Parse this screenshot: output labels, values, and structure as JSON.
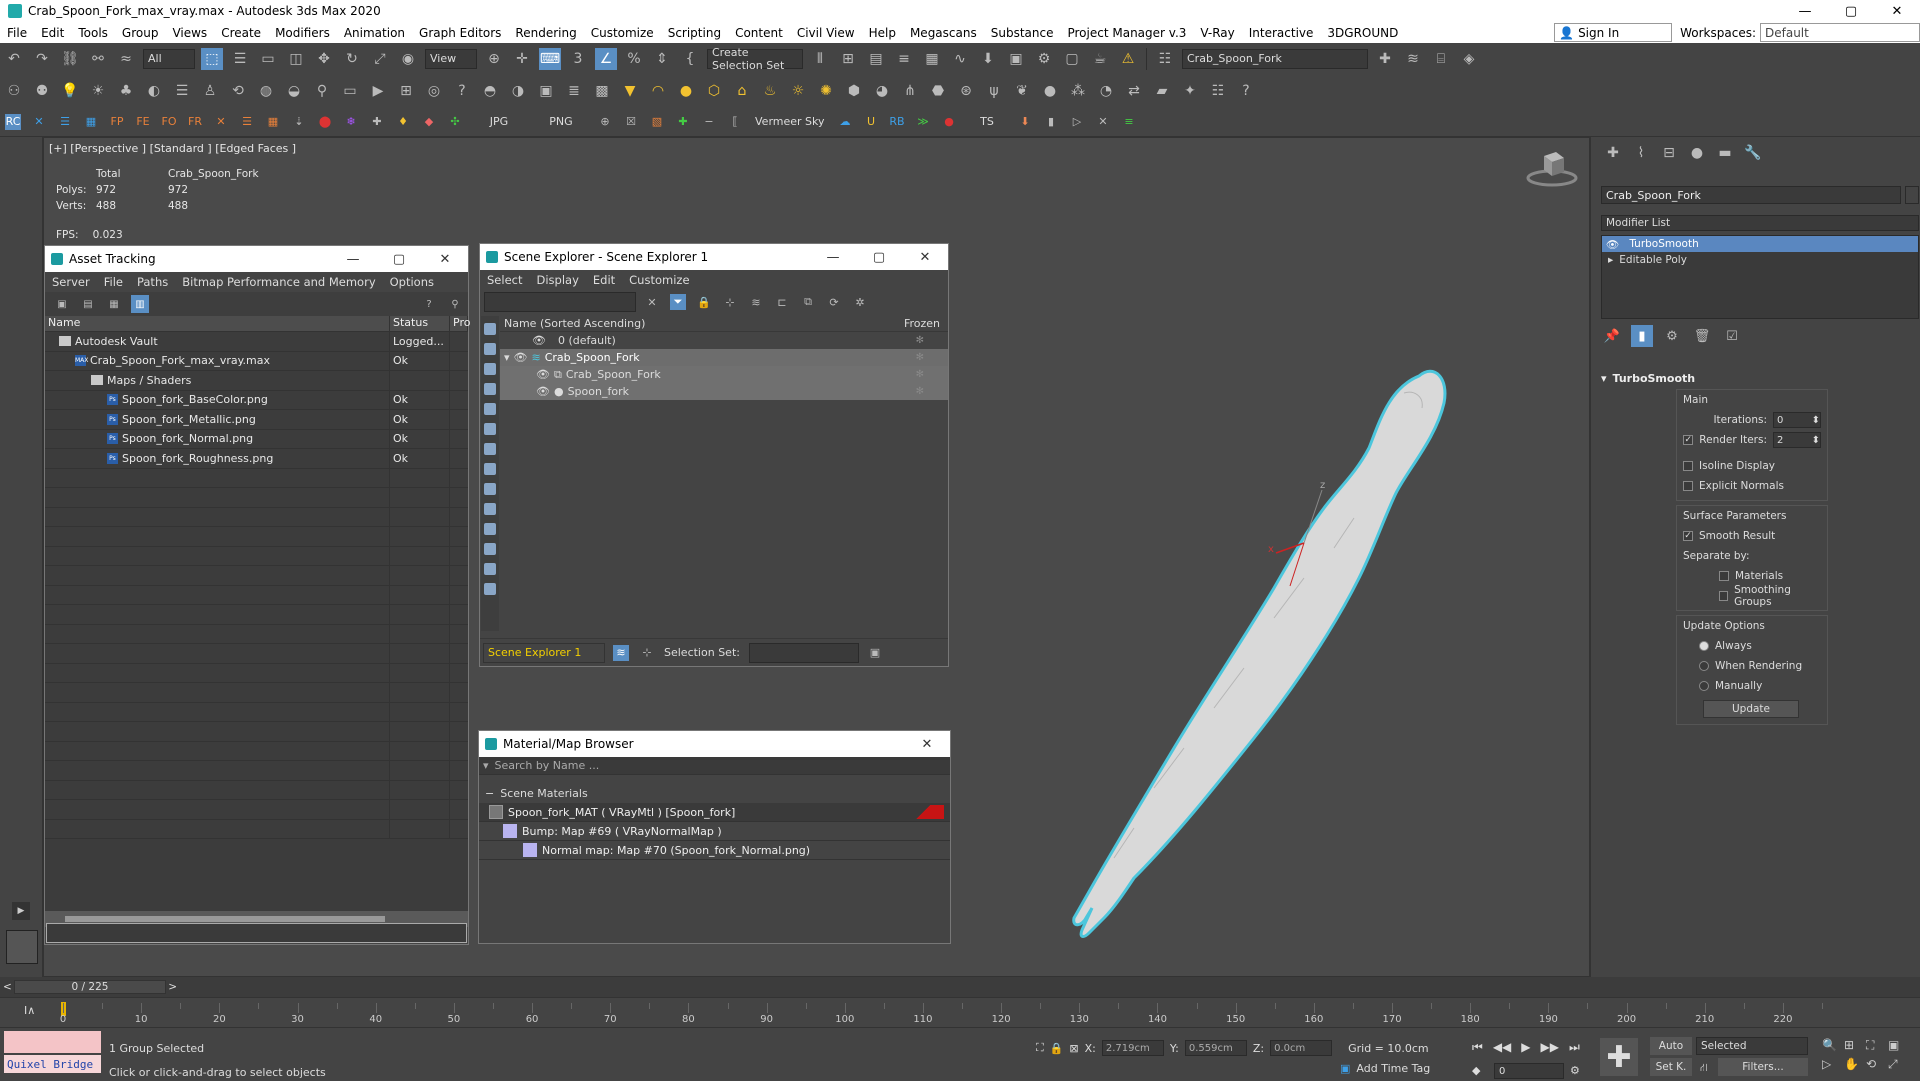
{
  "titlebar": {
    "title": "Crab_Spoon_Fork_max_vray.max - Autodesk 3ds Max 2020",
    "min": "—",
    "max": "▢",
    "close": "✕"
  },
  "menubar": {
    "items": [
      "File",
      "Edit",
      "Tools",
      "Group",
      "Views",
      "Create",
      "Modifiers",
      "Animation",
      "Graph Editors",
      "Rendering",
      "Customize",
      "Scripting",
      "Content",
      "Civil View",
      "Help",
      "Megascans",
      "Substance",
      "Project Manager v.3",
      "V-Ray",
      "Interactive",
      "3DGROUND"
    ],
    "signin": "Sign In",
    "workspaces_label": "Workspaces:",
    "workspace": "Default"
  },
  "toolbar": {
    "filter": "All",
    "refcoord": "View",
    "selection_set": "Create Selection Set",
    "layer": "Crab_Spoon_Fork",
    "jpg": "JPG",
    "png": "PNG",
    "vermeer": "Vermeer Sky",
    "ts": "TS"
  },
  "viewport": {
    "label": "[+] [Perspective ] [Standard ] [Edged Faces ]",
    "stats_header_total": "Total",
    "stats_header_obj": "Crab_Spoon_Fork",
    "polys_label": "Polys:",
    "polys_total": "972",
    "polys_obj": "972",
    "verts_label": "Verts:",
    "verts_total": "488",
    "verts_obj": "488",
    "fps_label": "FPS:",
    "fps_value": "0.023",
    "axis_x": "x",
    "axis_z": "z"
  },
  "asset_tracking": {
    "title": "Asset Tracking",
    "menu": [
      "Server",
      "File",
      "Paths",
      "Bitmap Performance and Memory",
      "Options"
    ],
    "col_name": "Name",
    "col_status": "Status",
    "col_pro": "Pro",
    "rows": [
      {
        "name": "Autodesk Vault",
        "status": "Logged..."
      },
      {
        "name": "Crab_Spoon_Fork_max_vray.max",
        "status": "Ok"
      },
      {
        "name": "Maps / Shaders",
        "status": ""
      },
      {
        "name": "Spoon_fork_BaseColor.png",
        "status": "Ok"
      },
      {
        "name": "Spoon_fork_Metallic.png",
        "status": "Ok"
      },
      {
        "name": "Spoon_fork_Normal.png",
        "status": "Ok"
      },
      {
        "name": "Spoon_fork_Roughness.png",
        "status": "Ok"
      }
    ]
  },
  "scene_explorer": {
    "title": "Scene Explorer - Scene Explorer 1",
    "menu": [
      "Select",
      "Display",
      "Edit",
      "Customize"
    ],
    "col_name": "Name (Sorted Ascending)",
    "col_frozen": "Frozen",
    "rows": [
      "0 (default)",
      "Crab_Spoon_Fork",
      "Crab_Spoon_Fork",
      "Spoon_fork"
    ],
    "footer_name": "Scene Explorer 1",
    "selection_set_label": "Selection Set:"
  },
  "material_browser": {
    "title": "Material/Map Browser",
    "search_placeholder": "Search by Name ...",
    "section": "Scene Materials",
    "rows": [
      "Spoon_fork_MAT  ( VRayMtl )  [Spoon_fork]",
      "Bump: Map #69  ( VRayNormalMap )",
      "Normal map: Map #70 (Spoon_fork_Normal.png)"
    ],
    "colors": {
      "mat_red": "#c81414",
      "map_lilac": "#b9b4f0"
    }
  },
  "command_panel": {
    "object_name": "Crab_Spoon_Fork",
    "modifier_list": "Modifier List",
    "stack": [
      "TurboSmooth",
      "Editable Poly"
    ],
    "rollout_title": "TurboSmooth",
    "main_label": "Main",
    "iterations_label": "Iterations:",
    "iterations": "0",
    "render_iters_label": "Render Iters:",
    "render_iters": "2",
    "isoline": "Isoline Display",
    "explicit_normals": "Explicit Normals",
    "surface_params": "Surface Parameters",
    "smooth_result": "Smooth Result",
    "separate_by": "Separate by:",
    "materials": "Materials",
    "smoothing_groups": "Smoothing Groups",
    "update_options": "Update Options",
    "always": "Always",
    "when_rendering": "When Rendering",
    "manually": "Manually",
    "update_btn": "Update"
  },
  "timeline": {
    "frame_display": "0 / 225",
    "ticks": [
      0,
      10,
      20,
      30,
      40,
      50,
      60,
      70,
      80,
      90,
      100,
      110,
      120,
      130,
      140,
      150,
      160,
      170,
      180,
      190,
      200,
      210,
      220
    ]
  },
  "statusbar": {
    "quixel": "Quixel Bridge",
    "selected": "1 Group Selected",
    "prompt": "Click or click-and-drag to select objects",
    "x_label": "X:",
    "x_value": "2.719cm",
    "y_label": "Y:",
    "y_value": "0.559cm",
    "z_label": "Z:",
    "z_value": "0.0cm",
    "grid": "Grid = 10.0cm",
    "add_time_tag": "Add Time Tag",
    "auto": "Auto",
    "set_k": "Set K.",
    "selected_combo": "Selected",
    "filters": "Filters...",
    "frame": "0"
  }
}
